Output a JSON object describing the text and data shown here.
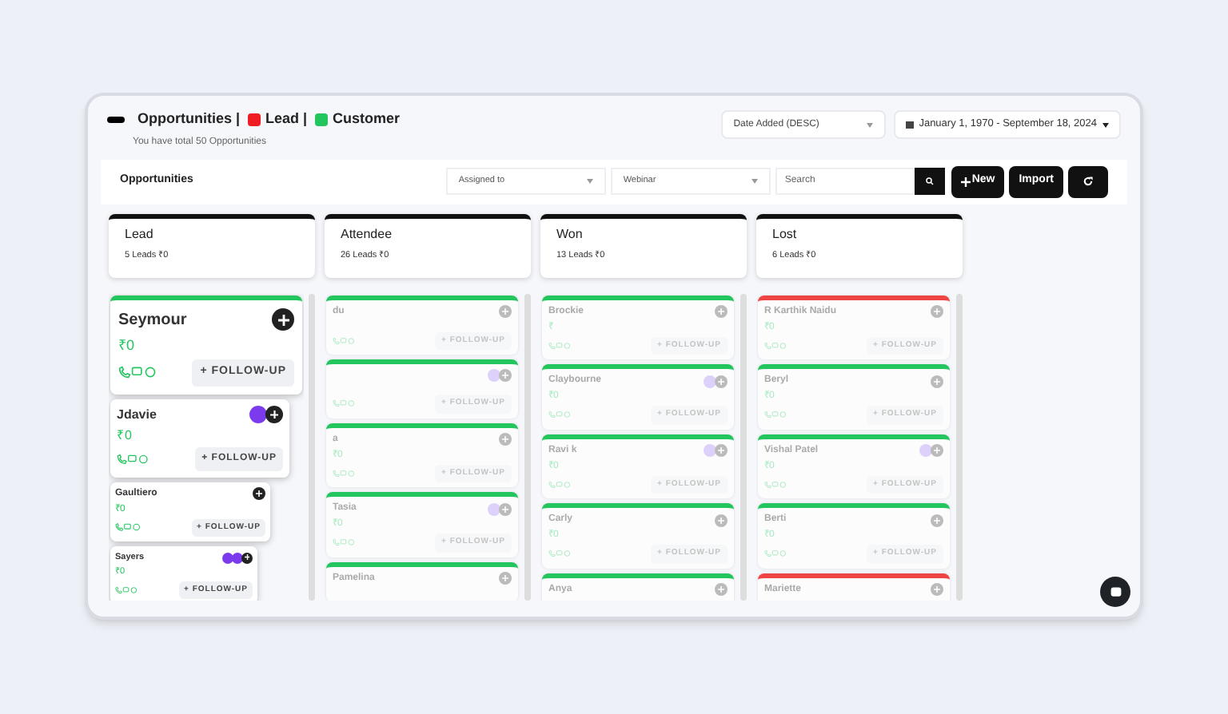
{
  "header": {
    "title": "Opportunities |",
    "legend": [
      {
        "label": "Lead |",
        "color": "#ef1c24"
      },
      {
        "label": "Customer",
        "color": "#22c55e"
      }
    ],
    "subtitle": "You have total 50 Opportunities",
    "sort": "Date Added (DESC)",
    "date_range": "January 1, 1970 - September 18, 2024"
  },
  "toolbar": {
    "title": "Opportunities",
    "assigned": "Assigned to",
    "source": "Webinar",
    "search_placeholder": "Search",
    "buttons": [
      {
        "kind": "new",
        "label": "New"
      },
      {
        "kind": "text",
        "label": "Import"
      },
      {
        "kind": "refresh"
      }
    ]
  },
  "dragging": true,
  "columns": [
    {
      "title": "Lead",
      "summary": "5 Leads ₹0"
    },
    {
      "title": "Attendee",
      "summary": "26 Leads ₹0",
      "cards": [
        {
          "name": "du",
          "color": "#22c55e",
          "action": "+ FOLLOW-UP"
        },
        {
          "color": "#22c55e",
          "avatars": [
            {
              "kind": "user"
            }
          ],
          "action": "+ FOLLOW-UP"
        },
        {
          "name": "a",
          "amount": "₹0",
          "color": "#22c55e",
          "action": "+ FOLLOW-UP"
        },
        {
          "name": "Tasia",
          "amount": "₹0",
          "color": "#22c55e",
          "avatars": [
            {
              "kind": "user"
            }
          ],
          "action": "+ FOLLOW-UP"
        },
        {
          "name": "Pamelina",
          "color": "#22c55e"
        }
      ]
    },
    {
      "title": "Won",
      "summary": "13 Leads ₹0",
      "cards": [
        {
          "name": "Brockie",
          "amount": "₹",
          "color": "#22c55e",
          "action": "+ FOLLOW-UP"
        },
        {
          "name": "Claybourne",
          "amount": "₹0",
          "color": "#22c55e",
          "avatars": [
            {
              "kind": "user"
            }
          ],
          "action": "+ FOLLOW-UP"
        },
        {
          "name": "Ravi k",
          "amount": "₹0",
          "color": "#22c55e",
          "avatars": [
            {
              "kind": "user"
            }
          ],
          "action": "+ FOLLOW-UP"
        },
        {
          "name": "Carly",
          "amount": "₹0",
          "color": "#22c55e",
          "action": "+ FOLLOW-UP"
        },
        {
          "name": "Anya",
          "color": "#22c55e"
        }
      ]
    },
    {
      "title": "Lost",
      "summary": "6 Leads ₹0",
      "cards": [
        {
          "name": "R Karthik Naidu",
          "amount": "₹0",
          "color": "#ef4444",
          "action": "+ FOLLOW-UP"
        },
        {
          "name": "Beryl",
          "amount": "₹0",
          "color": "#22c55e",
          "action": "+ FOLLOW-UP"
        },
        {
          "name": "Vishal Patel",
          "amount": "₹0",
          "color": "#22c55e",
          "avatars": [
            {
              "kind": "user"
            }
          ],
          "action": "+ FOLLOW-UP"
        },
        {
          "name": "Berti",
          "amount": "₹0",
          "color": "#22c55e",
          "action": "+ FOLLOW-UP"
        },
        {
          "name": "Mariette",
          "color": "#ef4444"
        }
      ]
    }
  ],
  "dragged_cards": [
    {
      "kind": "large",
      "name": "Seymour",
      "amount": "₹0",
      "color": "#22c55e",
      "action": "+ FOLLOW-UP"
    },
    {
      "kind": "medium",
      "name": "Jdavie",
      "amount": "₹0",
      "avatars": [
        {
          "kind": "user"
        }
      ],
      "action": "+ FOLLOW-UP"
    },
    {
      "kind": "small",
      "name": "Gaultiero",
      "amount": "₹0",
      "action": "+ FOLLOW-UP"
    },
    {
      "kind": "tiny",
      "name": "Sayers",
      "amount": "₹0",
      "avatars": [
        {
          "kind": "user"
        },
        {
          "kind": "user"
        }
      ],
      "action": "+ FOLLOW-UP"
    }
  ]
}
